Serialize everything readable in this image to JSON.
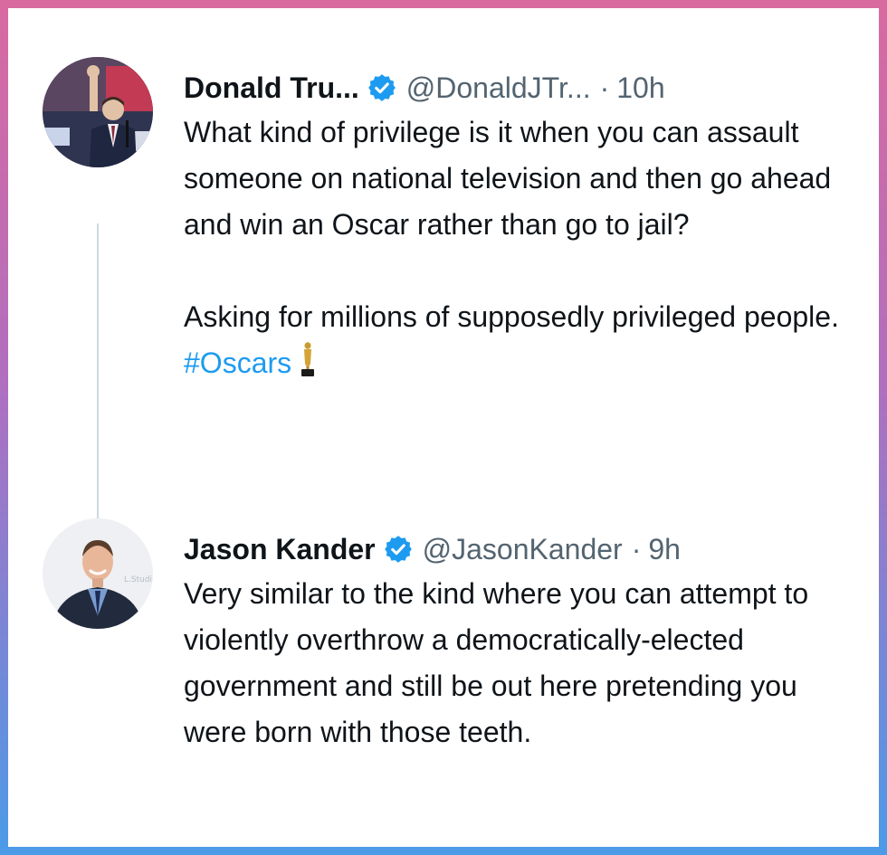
{
  "tweets": [
    {
      "author": "Donald Tru...",
      "handle": "@DonaldJTr...",
      "separator": "·",
      "time": "10h",
      "verified": true,
      "avatar": "avatar-man-waving-at-podium",
      "paragraph1": "What kind of privilege is it when you can assault someone on national television and then go ahead and win an Oscar rather than go to jail?",
      "paragraph2_text": "Asking for millions of supposedly privileged people.",
      "paragraph2_hashtag": "#Oscars",
      "emoji": "oscar-statuette-icon"
    },
    {
      "author": "Jason Kander",
      "handle": "@JasonKander",
      "separator": "·",
      "time": "9h",
      "verified": true,
      "avatar": "avatar-smiling-man-in-suit",
      "paragraph1": "Very similar to the kind where you can attempt to violently overthrow a democratically-elected government and still be out here pretending you were born with those teeth."
    }
  ],
  "colors": {
    "accent": "#1d9bf0",
    "text": "#0f1419",
    "secondary": "#536471",
    "thread_line": "#cfd9de",
    "border_gradient_top": "#d96aa0",
    "border_gradient_bottom": "#4b9be8"
  }
}
